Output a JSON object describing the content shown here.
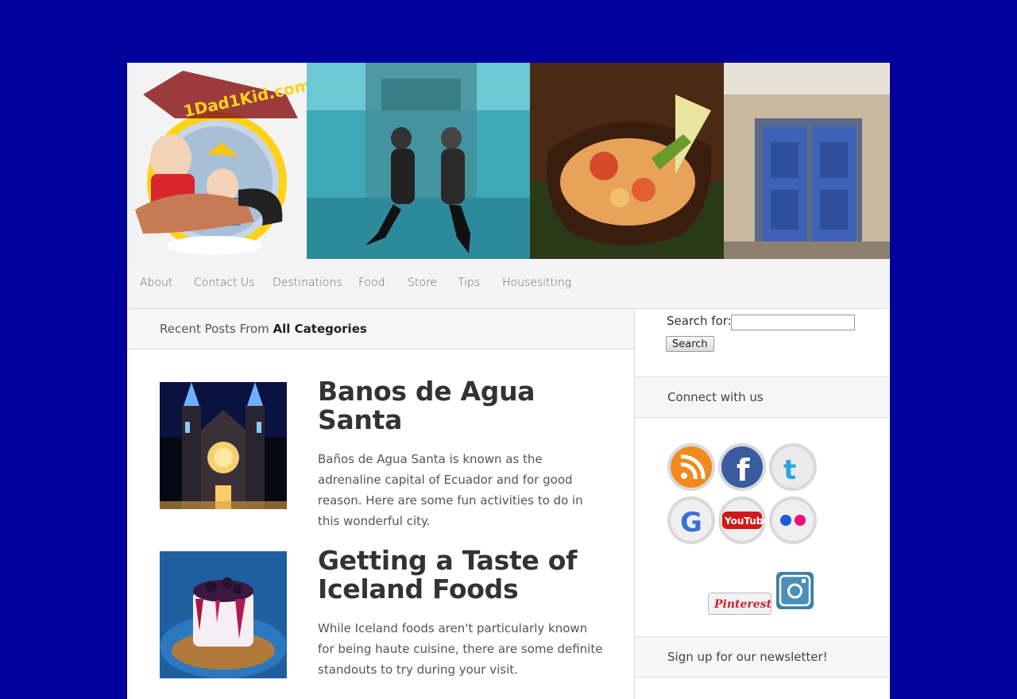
{
  "banner": {
    "logo_text": "1Dad1Kid.com"
  },
  "nav": {
    "items": [
      {
        "label": "About"
      },
      {
        "label": "Contact Us"
      },
      {
        "label": "Destinations"
      },
      {
        "label": "Food"
      },
      {
        "label": "Store"
      },
      {
        "label": "Tips"
      },
      {
        "label": "Housesitting"
      }
    ]
  },
  "recent": {
    "prefix": "Recent Posts From",
    "category": "All Categories"
  },
  "posts": [
    {
      "title": "Banos de Agua Santa",
      "excerpt": "Baños de Agua Santa is known as the adrenaline capital of Ecuador and for good reason. Here are some fun activities to do in this wonderful city."
    },
    {
      "title": "Getting a Taste of Iceland Foods",
      "excerpt": "While Iceland foods aren't particularly known for being haute cuisine, there are some definite standouts to try during your visit."
    }
  ],
  "sidebar": {
    "search_label": "Search for:",
    "search_value": "",
    "search_button": "Search",
    "connect_title": "Connect with us",
    "newsletter_title": "Sign up for our newsletter!",
    "social": {
      "rss": "rss-icon",
      "facebook": "facebook-icon",
      "twitter": "twitter-icon",
      "google": "google-icon",
      "youtube": "youtube-icon",
      "youtube_text": "YouTube",
      "flickr": "flickr-icon",
      "pinterest_text": "Pinterest",
      "instagram": "instagram-icon"
    }
  },
  "colors": {
    "page_bg": "#00009a",
    "nav_bg": "#f4f4f4",
    "title": "#333333"
  }
}
